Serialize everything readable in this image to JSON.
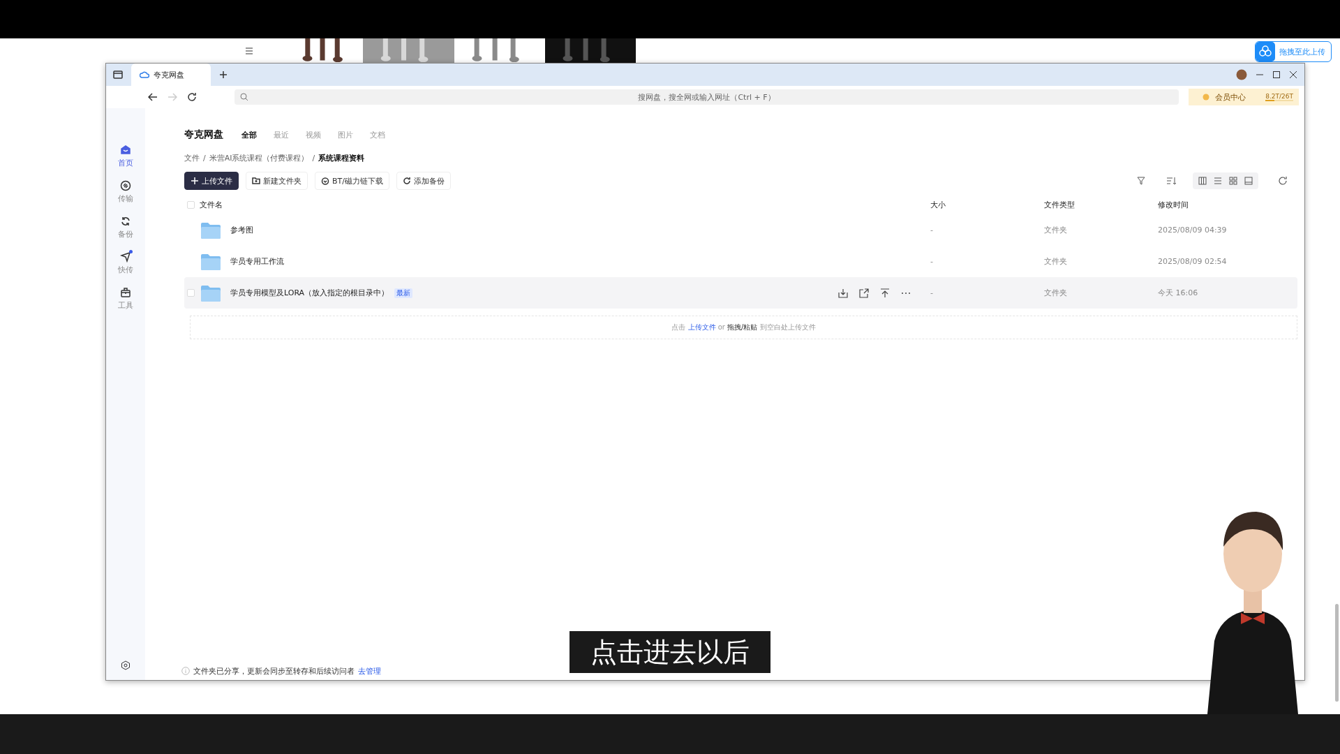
{
  "browser": {
    "tab_title": "夸克网盘",
    "search": {
      "placeholder": "搜网盘，搜全网或输入网址（Ctrl + F）"
    },
    "member": {
      "label": "会员中心",
      "storage": "8.2T/26T",
      "level": 0.32
    }
  },
  "floating_upload": {
    "label": "拖拽至此上传"
  },
  "sidebar": {
    "items": [
      {
        "label": "首页",
        "selected": true,
        "dot": false
      },
      {
        "label": "传输",
        "selected": false,
        "dot": false
      },
      {
        "label": "备份",
        "selected": false,
        "dot": false
      },
      {
        "label": "快传",
        "selected": false,
        "dot": true
      },
      {
        "label": "工具",
        "selected": false,
        "dot": false
      }
    ]
  },
  "app_title": "夸克网盘",
  "tabs": [
    {
      "label": "全部",
      "selected": true
    },
    {
      "label": "最近",
      "selected": false
    },
    {
      "label": "视频",
      "selected": false
    },
    {
      "label": "图片",
      "selected": false
    },
    {
      "label": "文档",
      "selected": false
    }
  ],
  "breadcrumb": {
    "separator": "/",
    "items": [
      "文件",
      "米营AI系统课程（付费课程）",
      "系统课程资料"
    ]
  },
  "toolbar": [
    {
      "label": "上传文件",
      "kind": "primary"
    },
    {
      "label": "新建文件夹",
      "kind": "folder"
    },
    {
      "label": "BT/磁力链下载",
      "kind": "bt"
    },
    {
      "label": "添加备份",
      "kind": "backup"
    }
  ],
  "table": {
    "select_all_checked": false,
    "columns": [
      "文件名",
      "大小",
      "文件类型",
      "修改时间"
    ],
    "rows": [
      {
        "name": "参考图",
        "size": "-",
        "type": "文件夹",
        "modified": "2025/08/09 04:39",
        "hovered": false,
        "checked": false
      },
      {
        "name": "学员专用工作流",
        "size": "-",
        "type": "文件夹",
        "modified": "2025/08/09 02:54",
        "hovered": false,
        "checked": false
      },
      {
        "name": "学员专用模型及LORA（放入指定的根目录中）",
        "badge": "最新",
        "size": "-",
        "type": "文件夹",
        "modified": "今天 16:06",
        "hovered": true,
        "checked": false
      }
    ]
  },
  "drop_zone": {
    "prefix": "点击",
    "link": "上传文件",
    "or": "or",
    "action": "拖拽/粘贴",
    "suffix": "到空白处上传文件"
  },
  "footer": {
    "text": "文件夹已分享，更新会同步至转存和后续访问者",
    "link": "去管理"
  },
  "subtitle": "点击进去以后"
}
